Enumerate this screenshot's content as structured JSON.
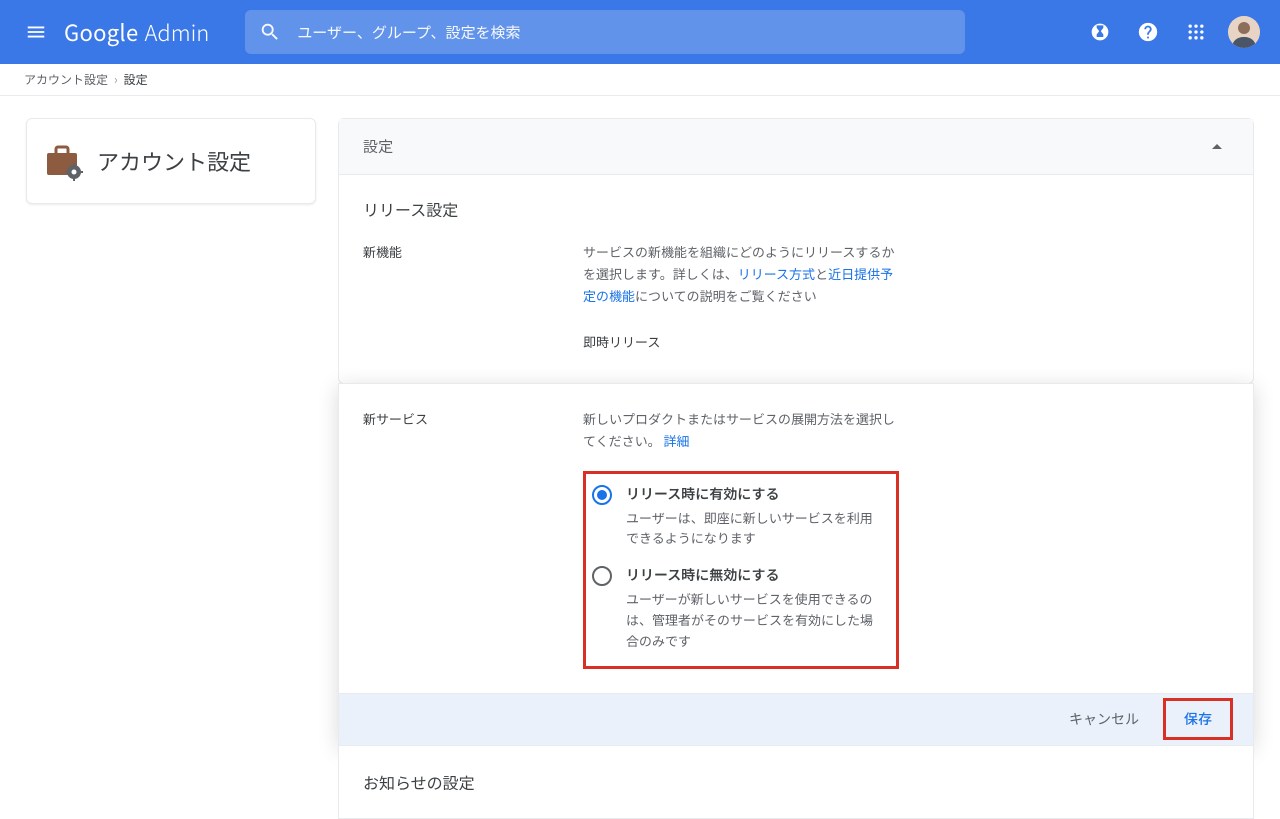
{
  "header": {
    "logo_primary": "Google",
    "logo_secondary": "Admin",
    "search_placeholder": "ユーザー、グループ、設定を検索"
  },
  "breadcrumb": {
    "item0": "アカウント設定",
    "current": "設定"
  },
  "side": {
    "title": "アカウント設定"
  },
  "panel": {
    "head": "設定",
    "sec1_title": "リリース設定",
    "sec1_label": "新機能",
    "sec1_desc_a": "サービスの新機能を組織にどのようにリリースするかを選択します。詳しくは、",
    "sec1_link1": "リリース方式",
    "sec1_desc_b": "と",
    "sec1_link2": "近日提供予定の機能",
    "sec1_desc_c": "についての説明をご覧ください",
    "sec1_rapid": "即時リリース",
    "sec2_label": "新サービス",
    "sec2_desc": "新しいプロダクトまたはサービスの展開方法を選択してください。 ",
    "sec2_link": "詳細",
    "radio1_title": "リリース時に有効にする",
    "radio1_sub": "ユーザーは、即座に新しいサービスを利用できるようになります",
    "radio2_title": "リリース時に無効にする",
    "radio2_sub": "ユーザーが新しいサービスを使用できるのは、管理者がそのサービスを有効にした場合のみです",
    "cancel": "キャンセル",
    "save": "保存",
    "sec3_title": "お知らせの設定"
  }
}
